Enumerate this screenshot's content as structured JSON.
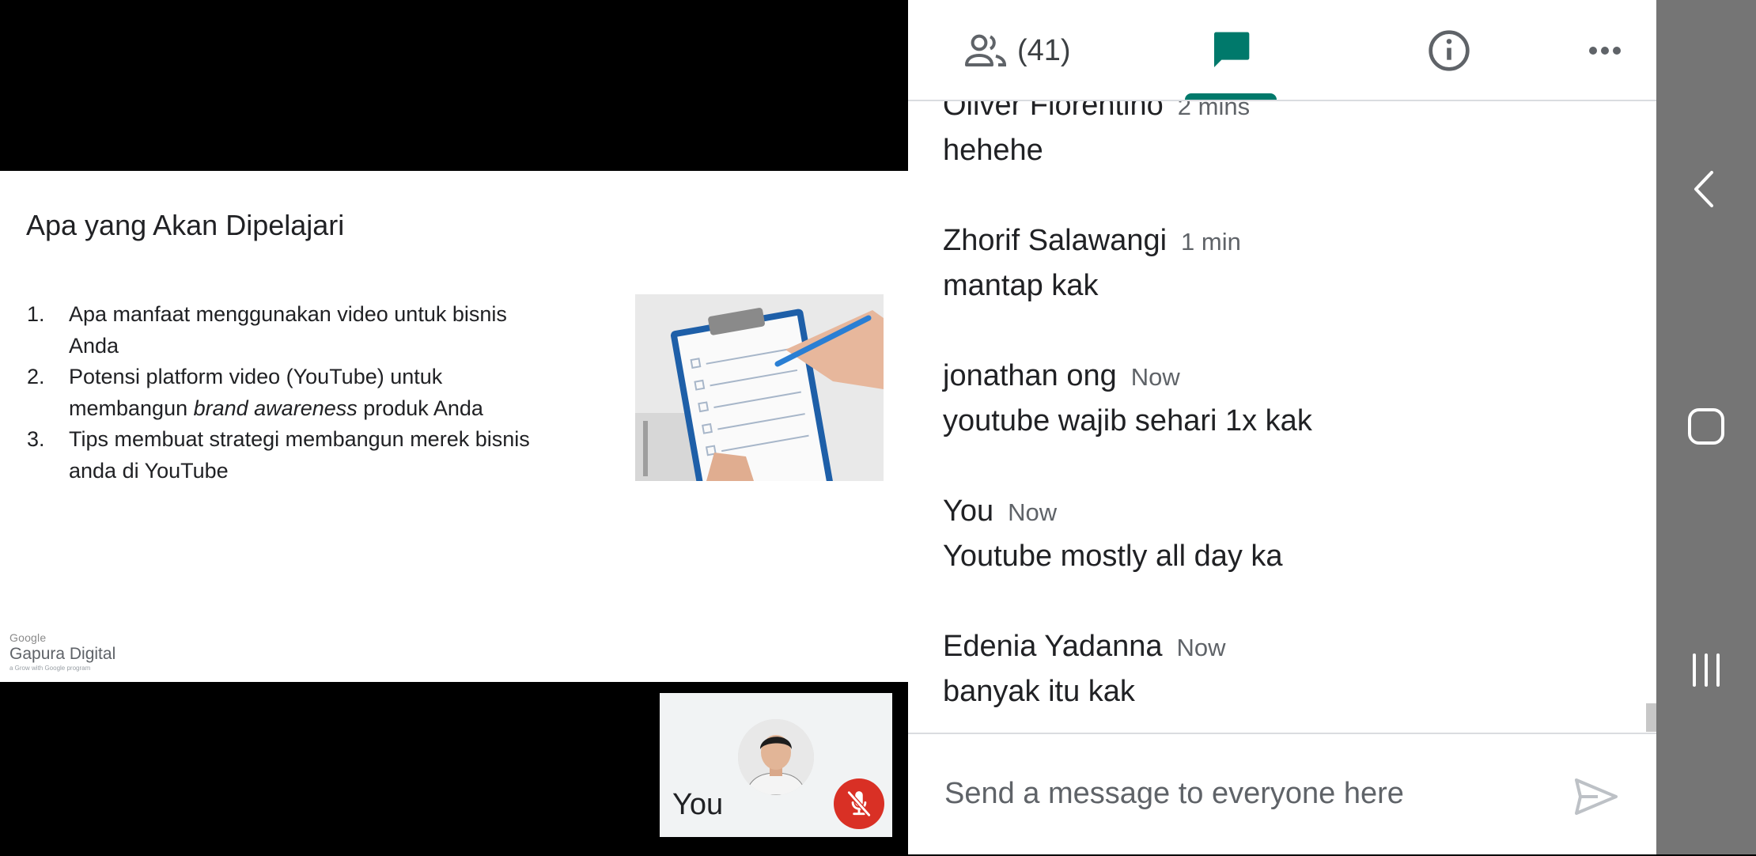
{
  "presentation": {
    "title": "Apa yang Akan Dipelajari",
    "items": [
      {
        "num": "1.",
        "text": "Apa manfaat menggunakan video untuk bisnis Anda"
      },
      {
        "num": "2.",
        "text_before": "Potensi platform video (YouTube) untuk membangun ",
        "text_italic": "brand awareness",
        "text_after": " produk Anda"
      },
      {
        "num": "3.",
        "text": "Tips membuat strategi membangun merek bisnis anda di YouTube"
      }
    ],
    "brand": {
      "google": "Google",
      "name": "Gapura Digital",
      "tagline": "a Grow with Google program"
    }
  },
  "self_view": {
    "label": "You",
    "mic_icon": "mic-off-icon"
  },
  "tabs": {
    "people_count": "(41)",
    "people_icon": "people-icon",
    "chat_icon": "chat-icon",
    "info_icon": "info-icon",
    "more_icon": "more-horiz-icon"
  },
  "messages": [
    {
      "name": "Oliver Florentino",
      "time": "2 mins",
      "text": "hehehe"
    },
    {
      "name": "Zhorif Salawangi",
      "time": "1 min",
      "text": "mantap kak"
    },
    {
      "name": "jonathan ong",
      "time": "Now",
      "text": "youtube wajib sehari 1x kak"
    },
    {
      "name": "You",
      "time": "Now",
      "text": "Youtube mostly all day ka"
    },
    {
      "name": "Edenia Yadanna",
      "time": "Now",
      "text": "banyak itu kak"
    }
  ],
  "composer": {
    "placeholder": "Send a message to everyone here",
    "send_icon": "send-icon"
  },
  "colors": {
    "accent": "#00796b",
    "mic_off": "#d93025",
    "navbar": "#757575"
  }
}
